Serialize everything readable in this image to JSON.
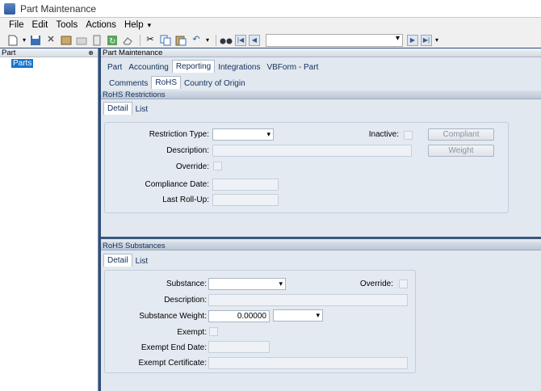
{
  "window": {
    "title": "Part Maintenance"
  },
  "menu": [
    "File",
    "Edit",
    "Tools",
    "Actions",
    "Help"
  ],
  "toolbar": {
    "icons": [
      "new-icon",
      "save-icon",
      "delete-icon",
      "book-icon",
      "folder-icon",
      "attach-icon",
      "refresh-icon",
      "eraser-icon",
      "cut-icon",
      "copy-icon",
      "paste-icon",
      "undo-icon",
      "binoculars-icon"
    ],
    "nav_combo_value": ""
  },
  "left": {
    "header": "Part",
    "pin": "⊕",
    "tree_item": "Parts"
  },
  "right": {
    "header": "Part Maintenance",
    "main_tabs": [
      "Part",
      "Accounting",
      "Reporting",
      "Integrations",
      "VBForm - Part"
    ],
    "active_main_tab": "Reporting",
    "sub_tabs": [
      "Comments",
      "RoHS",
      "Country of Origin"
    ],
    "active_sub_tab": "RoHS"
  },
  "restrictions": {
    "section_title": "RoHS Restrictions",
    "tabs": [
      "Detail",
      "List"
    ],
    "labels": {
      "restriction_type": "Restriction Type:",
      "inactive": "Inactive:",
      "description": "Description:",
      "override": "Override:",
      "compliance_date": "Compliance Date:",
      "last_rollup": "Last Roll-Up:"
    },
    "buttons": {
      "compliant": "Compliant",
      "weight": "Weight"
    },
    "values": {
      "restriction_type": "",
      "description": "",
      "compliance_date": "",
      "last_rollup": ""
    }
  },
  "substances": {
    "section_title": "RoHS Substances",
    "tabs": [
      "Detail",
      "List"
    ],
    "labels": {
      "substance": "Substance:",
      "override": "Override:",
      "description": "Description:",
      "substance_weight": "Substance Weight:",
      "exempt": "Exempt:",
      "exempt_end_date": "Exempt End Date:",
      "exempt_certificate": "Exempt Certificate:"
    },
    "values": {
      "substance": "",
      "description": "",
      "substance_weight": "0.00000",
      "weight_unit": "",
      "exempt_end_date": "",
      "exempt_certificate": ""
    }
  }
}
